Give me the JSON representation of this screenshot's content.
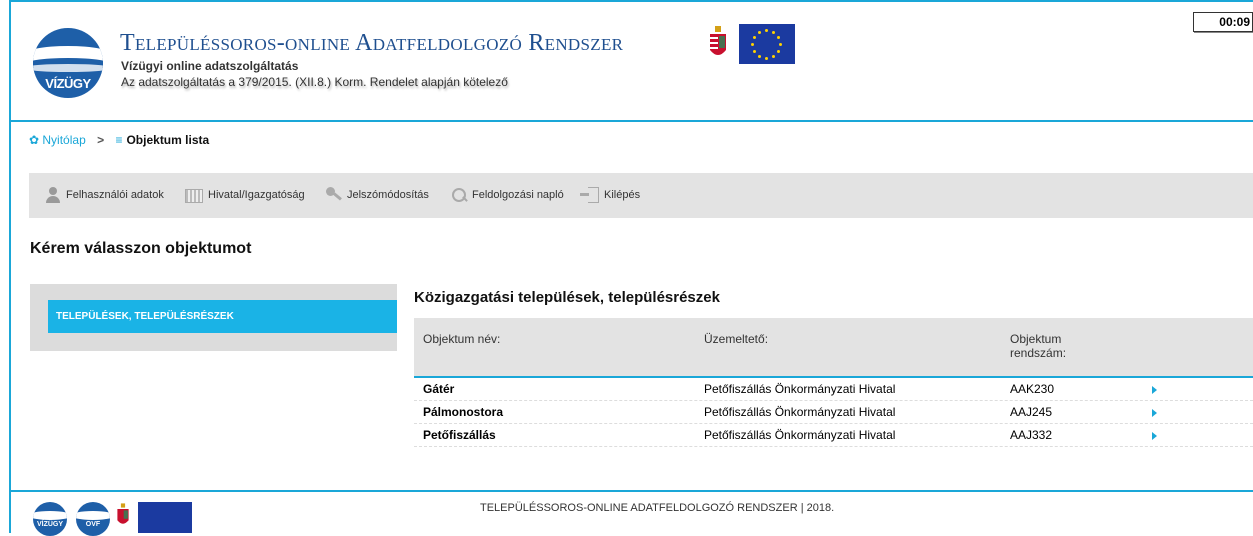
{
  "header": {
    "logo_text": "VÍZÜGY",
    "title": "Településsoros-online Adatfeldolgozó Rendszer",
    "subtitle": "Vízügyi online adatszolgáltatás",
    "subtitle2": "Az adatszolgáltatás a 379/2015. (XII.8.) Korm. Rendelet alapján kötelező",
    "timer": "00:09"
  },
  "breadcrumb": {
    "home": "Nyitólap",
    "separator": ">",
    "current": "Objektum lista"
  },
  "menu": [
    {
      "label": "Felhasználói adatok",
      "icon": "user-icon"
    },
    {
      "label": "Hivatal/Igazgatóság",
      "icon": "building-icon"
    },
    {
      "label": "Jelszómódosítás",
      "icon": "key-icon"
    },
    {
      "label": "Feldolgozási napló",
      "icon": "search-icon"
    },
    {
      "label": "Kilépés",
      "icon": "exit-icon"
    }
  ],
  "page_heading": "Kérem válasszon objektumot",
  "sidebar": {
    "active_item": "TELEPÜLÉSEK, TELEPÜLÉSRÉSZEK"
  },
  "section_title": "Közigazgatási települések, településrészek",
  "table": {
    "headers": {
      "name": "Objektum név:",
      "operator": "Üzemeltető:",
      "code_line1": "Objektum",
      "code_line2": "rendszám:"
    },
    "rows": [
      {
        "name": "Gátér",
        "operator": "Petőfiszállás Önkormányzati Hivatal",
        "code": "AAK230"
      },
      {
        "name": "Pálmonostora",
        "operator": "Petőfiszállás Önkormányzati Hivatal",
        "code": "AAJ245"
      },
      {
        "name": "Petőfiszállás",
        "operator": "Petőfiszállás Önkormányzati Hivatal",
        "code": "AAJ332"
      }
    ]
  },
  "footer": {
    "text": "TELEPÜLÉSSOROS-ONLINE ADATFELDOLGOZÓ RENDSZER | 2018.",
    "logo1_text": "VÍZÜGY",
    "logo2_text": "OVF"
  },
  "colors": {
    "accent": "#1aa7d8",
    "active_tab": "#1ab3e6",
    "title_blue": "#1f4f8f",
    "menu_bg": "#e3e3e3"
  }
}
